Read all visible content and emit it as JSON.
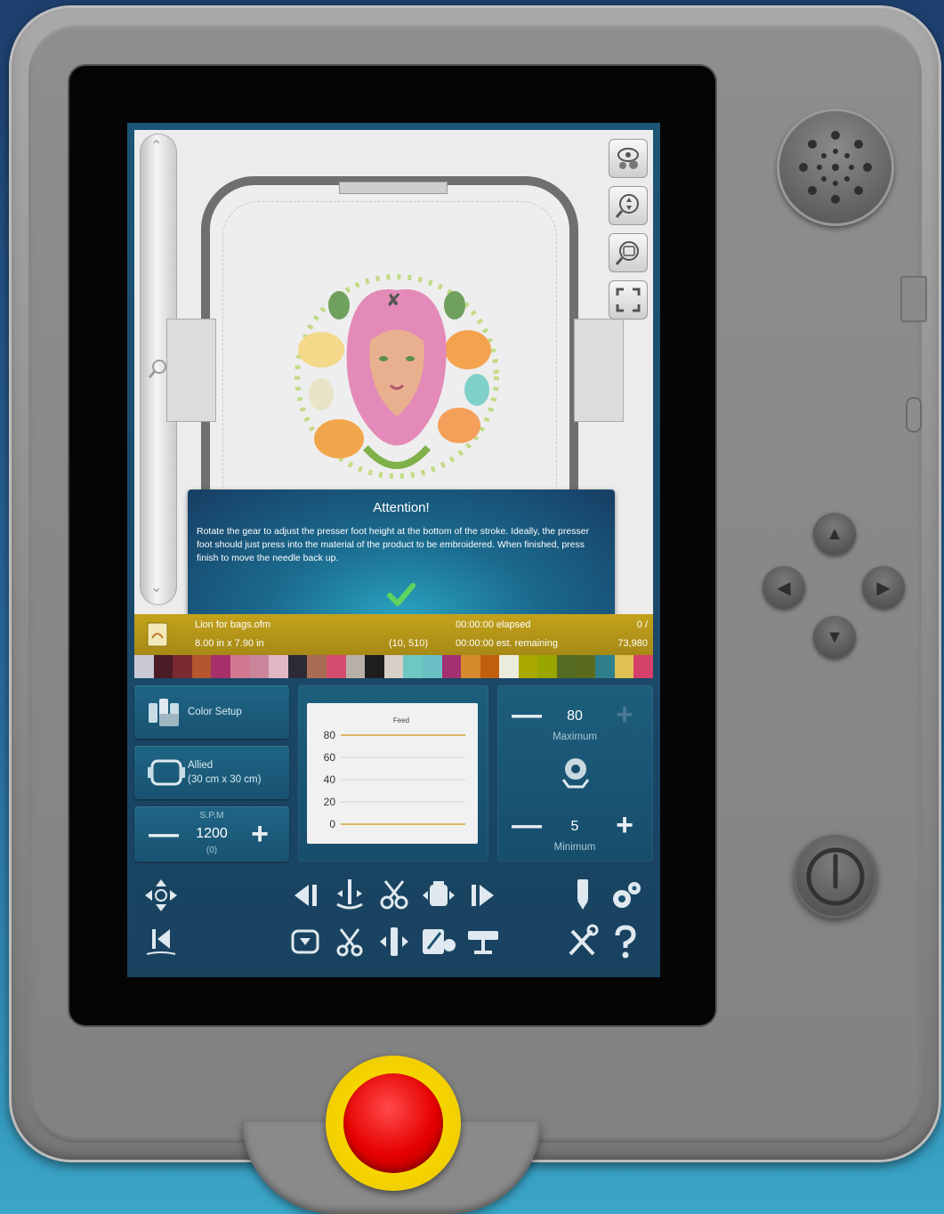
{
  "popup": {
    "title": "Attention!",
    "message": "Rotate the gear to adjust the presser foot height at the bottom of the stroke. Ideally, the presser foot should just press into the material of the product to be embroidered. When finished, press finish to move the needle back up."
  },
  "status": {
    "file_name": "Lion for bags.ofm",
    "dimensions": "8.00 in x 7.90 in",
    "position": "(10, 510)",
    "elapsed": "00:00:00 elapsed",
    "remaining": "00:00:00 est. remaining",
    "stitch_current": "0 /",
    "stitch_total": "73,980"
  },
  "color_bar": [
    "#c9c9d6",
    "#4a1c26",
    "#7a2a30",
    "#b5562e",
    "#a8306a",
    "#d27893",
    "#c9869a",
    "#e0b8c3",
    "#2d2a38",
    "#a86b53",
    "#d64c6e",
    "#b8b0a8",
    "#1e1e1e",
    "#d6d0c6",
    "#6ec7c0",
    "#69bfc4",
    "#a23070",
    "#d58a2e",
    "#c0600f",
    "#ececdc",
    "#a8a800",
    "#9aa600",
    "#566a24",
    "#5a6b20",
    "#2f7f8c",
    "#e0c050",
    "#d4406a"
  ],
  "panels": {
    "color_setup_label": "Color Setup",
    "hoop_label": "Allied",
    "hoop_size": "(30 cm x 30 cm)",
    "spm_label": "S.P.M",
    "spm_value": "1200",
    "spm_sub": "(0)"
  },
  "feed_chart": {
    "title": "Feed",
    "ticks": [
      "80",
      "60",
      "40",
      "20",
      "0"
    ]
  },
  "chart_data": {
    "type": "line",
    "title": "Feed",
    "ylim": [
      0,
      80
    ],
    "yticks": [
      0,
      20,
      40,
      60,
      80
    ],
    "series": [
      {
        "values": [
          80,
          80
        ]
      },
      {
        "values": [
          0,
          0
        ]
      }
    ]
  },
  "feed_limits": {
    "max_value": "80",
    "max_label": "Maximum",
    "min_value": "5",
    "min_label": "Minimum"
  },
  "colors": {
    "accent": "#1d5e7d",
    "status_bar": "#b8981a",
    "chart_line": "#d4a530",
    "estop": "#e60000",
    "estop_ring": "#f5d400"
  }
}
